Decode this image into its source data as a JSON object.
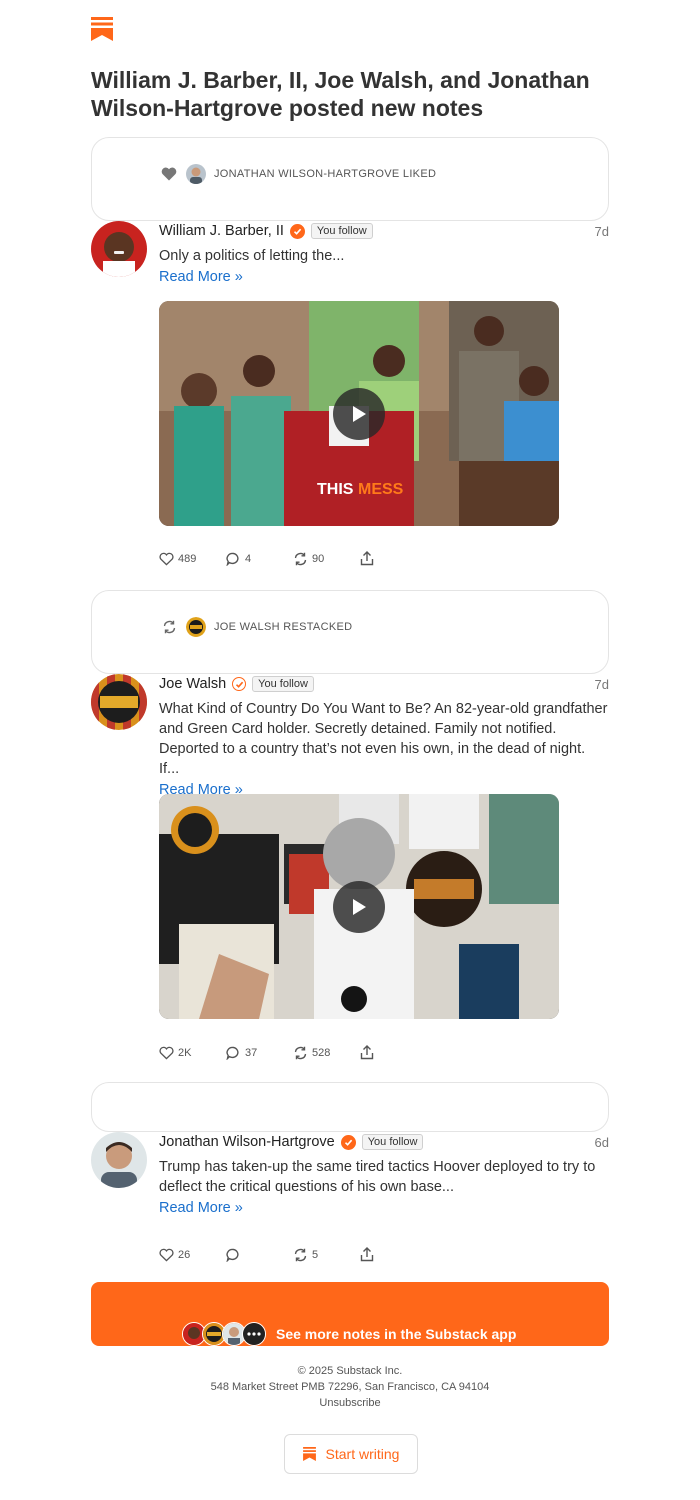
{
  "headline": "William J. Barber, II, Joe Walsh, and Jonathan Wilson-Hartgrove posted new notes",
  "notes": [
    {
      "context_text": "JONATHAN WILSON-HARTGROVE LIKED",
      "context_icon": "heart-icon",
      "author": "William J. Barber, II",
      "follow_label": "You follow",
      "time": "7d",
      "text": "Only a politics of letting the...",
      "read_more": "Read More »",
      "video_caption_a": "THIS",
      "video_caption_b": "MESS",
      "likes": "489",
      "comments": "4",
      "restacks": "90"
    },
    {
      "context_text": "JOE WALSH RESTACKED",
      "context_icon": "restack-icon",
      "author": "Joe Walsh",
      "follow_label": "You follow",
      "time": "7d",
      "text": "What Kind of Country Do You Want to Be? An 82-year-old grandfather and Green Card holder. Secretly detained. Family not notified. Deported to a country that’s not even his own, in the dead of night. If...",
      "read_more": "Read More »",
      "likes": "2K",
      "comments": "37",
      "restacks": "528"
    },
    {
      "author": "Jonathan Wilson-Hartgrove",
      "follow_label": "You follow",
      "time": "6d",
      "text": "Trump has taken-up the same tired tactics Hoover deployed to try to deflect the critical questions of his own base...",
      "read_more": "Read More »",
      "likes": "26",
      "comments": "",
      "restacks": "5"
    }
  ],
  "cta_label": "See more notes in the Substack app",
  "footer": {
    "copyright": "© 2025 Substack Inc.",
    "address": "548 Market Street PMB 72296, San Francisco, CA 94104",
    "unsubscribe": "Unsubscribe"
  },
  "start_writing": "Start writing",
  "colors": {
    "accent": "#ff6719",
    "link": "#1a6fcc"
  }
}
